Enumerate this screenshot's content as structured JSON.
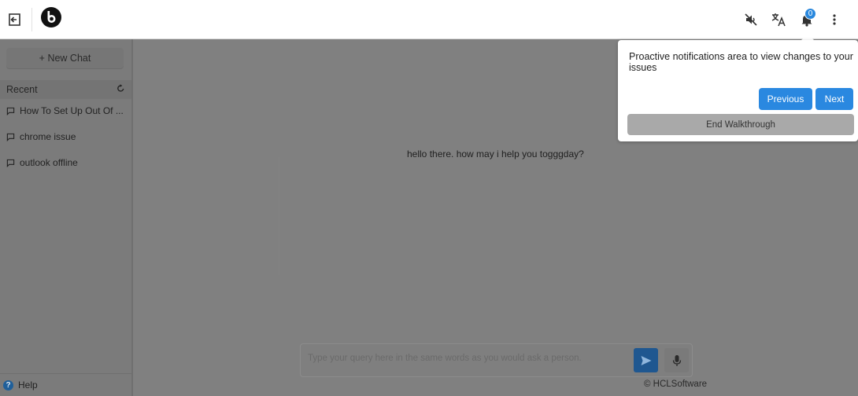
{
  "header": {
    "icons": [
      "exit-icon",
      "brand-logo",
      "speaker-muted-icon",
      "translate-icon",
      "bell-icon",
      "kebab-menu-icon"
    ],
    "notification_count": "0"
  },
  "sidebar": {
    "new_chat_label": "+ New Chat",
    "recent_label": "Recent",
    "chats": [
      {
        "label": "How To Set Up Out Of ..."
      },
      {
        "label": "chrome issue"
      },
      {
        "label": "outlook offline"
      }
    ],
    "help_label": "Help"
  },
  "main": {
    "greeting": "hello there. how may i help you togggday?",
    "input_placeholder": "Type your query here in the same words as you would ask a person.",
    "copyright": "© HCLSoftware"
  },
  "walkthrough": {
    "text": "Proactive notifications area to view changes to your issues",
    "previous_label": "Previous",
    "next_label": "Next",
    "end_label": "End Walkthrough"
  },
  "colors": {
    "accent": "#2a88e0",
    "send_button": "#1f5790",
    "overlay": "#808080"
  }
}
